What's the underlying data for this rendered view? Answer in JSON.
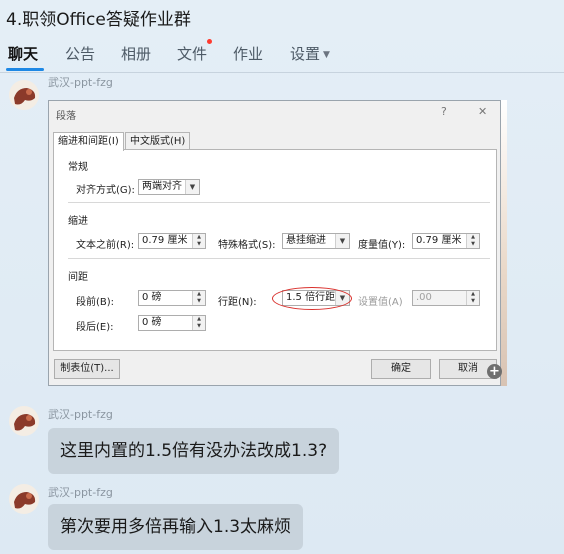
{
  "header": {
    "title": "4.职领Office答疑作业群"
  },
  "tabs": [
    {
      "label": "聊天"
    },
    {
      "label": "公告"
    },
    {
      "label": "相册"
    },
    {
      "label": "文件"
    },
    {
      "label": "作业"
    },
    {
      "label": "设置"
    }
  ],
  "messages": [
    {
      "sender": "武汉-ppt-fzg",
      "type": "image"
    },
    {
      "sender": "武汉-ppt-fzg",
      "text": "这里内置的1.5倍有没办法改成1.3?"
    },
    {
      "sender": "武汉-ppt-fzg",
      "text": "第次要用多倍再输入1.3太麻烦"
    }
  ],
  "dialog": {
    "title": "段落",
    "help": "?",
    "close": "✕",
    "tabs": [
      "缩进和间距(I)",
      "中文版式(H)"
    ],
    "general": {
      "heading": "常规",
      "align_label": "对齐方式(G):",
      "align_value": "两端对齐"
    },
    "indent": {
      "heading": "缩进",
      "before_label": "文本之前(R):",
      "before_value": "0.79 厘米",
      "special_label": "特殊格式(S):",
      "special_value": "悬挂缩进",
      "by_label": "度量值(Y):",
      "by_value": "0.79 厘米"
    },
    "spacing": {
      "heading": "间距",
      "before_label": "段前(B):",
      "before_value": "0 磅",
      "after_label": "段后(E):",
      "after_value": "0 磅",
      "line_label": "行距(N):",
      "line_value": "1.5 倍行距",
      "at_label": "设置值(A)",
      "at_value": ".00"
    },
    "buttons": {
      "tabs": "制表位(T)...",
      "ok": "确定",
      "cancel": "取消"
    }
  },
  "colors": {
    "accent": "#1e88e5",
    "highlight_ring": "#d9302c",
    "bubble": "#c8d3dc"
  }
}
